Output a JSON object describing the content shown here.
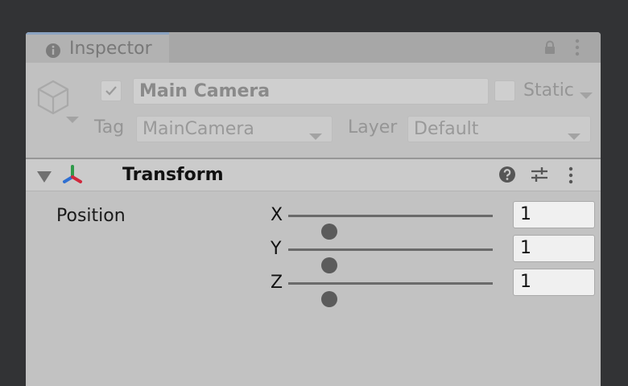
{
  "window": {
    "tab_title": "Inspector"
  },
  "header": {
    "object_name": "Main Camera",
    "static_label": "Static",
    "tag_label": "Tag",
    "tag_value": "MainCamera",
    "layer_label": "Layer",
    "layer_value": "Default"
  },
  "component": {
    "title": "Transform",
    "position_label": "Position",
    "axes": [
      {
        "label": "X",
        "value": "1",
        "slider_fraction": 0.2
      },
      {
        "label": "Y",
        "value": "1",
        "slider_fraction": 0.2
      },
      {
        "label": "Z",
        "value": "1",
        "slider_fraction": 0.2
      }
    ]
  },
  "icons": [
    "info-icon",
    "lock-icon",
    "kebab-menu-icon",
    "gameobject-cube-icon",
    "checkmark-icon",
    "dropdown-arrow-icon",
    "foldout-triangle-icon",
    "transform-axes-icon",
    "help-icon",
    "preset-sliders-icon"
  ],
  "colors": {
    "background": "#323335",
    "panel": "#c2c2c2",
    "tab_accent": "#8ba3c1",
    "transform_red": "#d0283c",
    "transform_green": "#2e9a4a",
    "transform_blue": "#2f6fd1"
  }
}
